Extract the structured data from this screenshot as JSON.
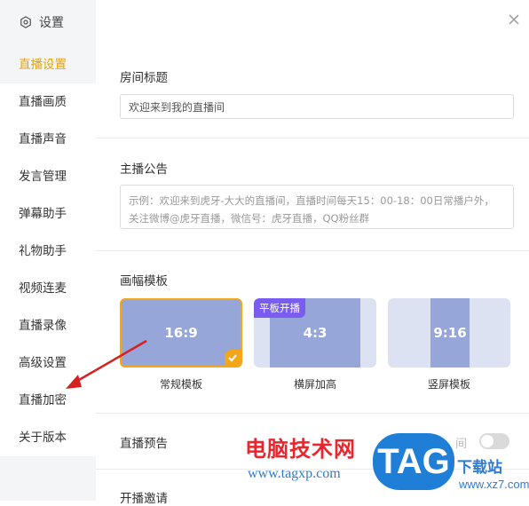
{
  "sidebar": {
    "header_label": "设置",
    "header_icon": "gear-icon",
    "items": [
      {
        "label": "直播设置",
        "active": true
      },
      {
        "label": "直播画质"
      },
      {
        "label": "直播声音"
      },
      {
        "label": "发言管理"
      },
      {
        "label": "弹幕助手"
      },
      {
        "label": "礼物助手"
      },
      {
        "label": "视频连麦"
      },
      {
        "label": "直播录像"
      },
      {
        "label": "高级设置"
      },
      {
        "label": "直播加密"
      },
      {
        "label": "关于版本"
      }
    ]
  },
  "close_icon": "close-icon",
  "room_title": {
    "label": "房间标题",
    "value": "欢迎来到我的直播间"
  },
  "announcement": {
    "label": "主播公告",
    "placeholder_line1": "示例：欢迎来到虎牙-大大的直播间，直播时间每天15：00-18：00日常播户外，",
    "placeholder_line2": "关注微博@虎牙直播，微信号：虎牙直播，QQ粉丝群"
  },
  "template": {
    "label": "画幅模板",
    "options": [
      {
        "ratio": "16:9",
        "name": "常规模板",
        "selected": true
      },
      {
        "ratio": "4:3",
        "name": "横屏加高",
        "badge": "平板开播"
      },
      {
        "ratio": "9:16",
        "name": "竖屏模板"
      }
    ]
  },
  "preview": {
    "label": "直播预告",
    "partial_text": "间",
    "enabled": false
  },
  "invite": {
    "label": "开播邀请"
  },
  "watermark": {
    "cn": "电脑技术网",
    "url": "www.tagxp.com",
    "logo": "TAG",
    "download": "下载站",
    "site": "www.xz7.com"
  },
  "colors": {
    "accent": "#e8a200",
    "selected_border": "#f2a618",
    "badge": "#7b5cf0",
    "template_fill": "#97a6d8",
    "arrow": "#d42020"
  }
}
